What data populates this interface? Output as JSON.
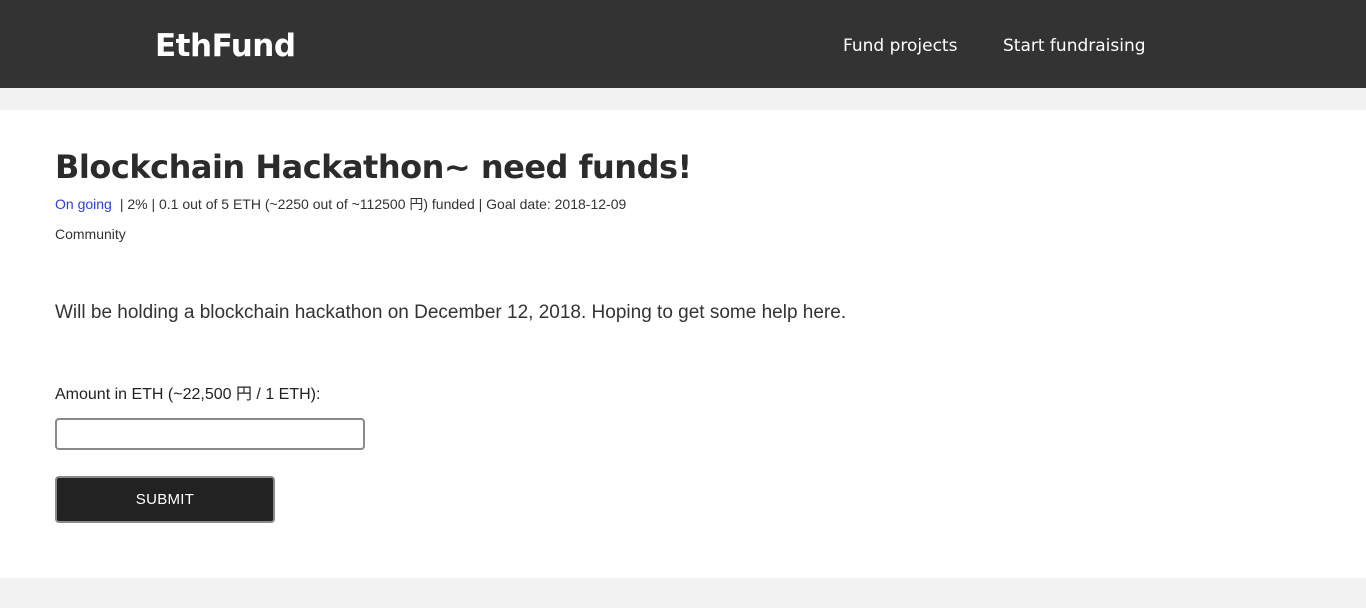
{
  "nav": {
    "brand": "EthFund",
    "links": [
      {
        "label": "Fund projects"
      },
      {
        "label": "Start fundraising"
      }
    ]
  },
  "project": {
    "title": "Blockchain Hackathon~ need funds!",
    "status": "On going",
    "meta": "| 2% | 0.1 out of 5 ETH (~2250 out of ~112500 円) funded | Goal date: 2018-12-09",
    "percent_funded": 2,
    "category": "Community",
    "description": "Will be holding a blockchain hackathon on December 12, 2018. Hoping to get some help here."
  },
  "form": {
    "amount_label": "Amount in ETH (~22,500 円 / 1 ETH):",
    "amount_value": "",
    "amount_placeholder": "",
    "submit_label": "SUBMIT"
  },
  "colors": {
    "navbar_bg": "#333333",
    "page_bg": "#f2f2f2",
    "status_link": "#2a3fd6",
    "button_bg": "#222222"
  }
}
